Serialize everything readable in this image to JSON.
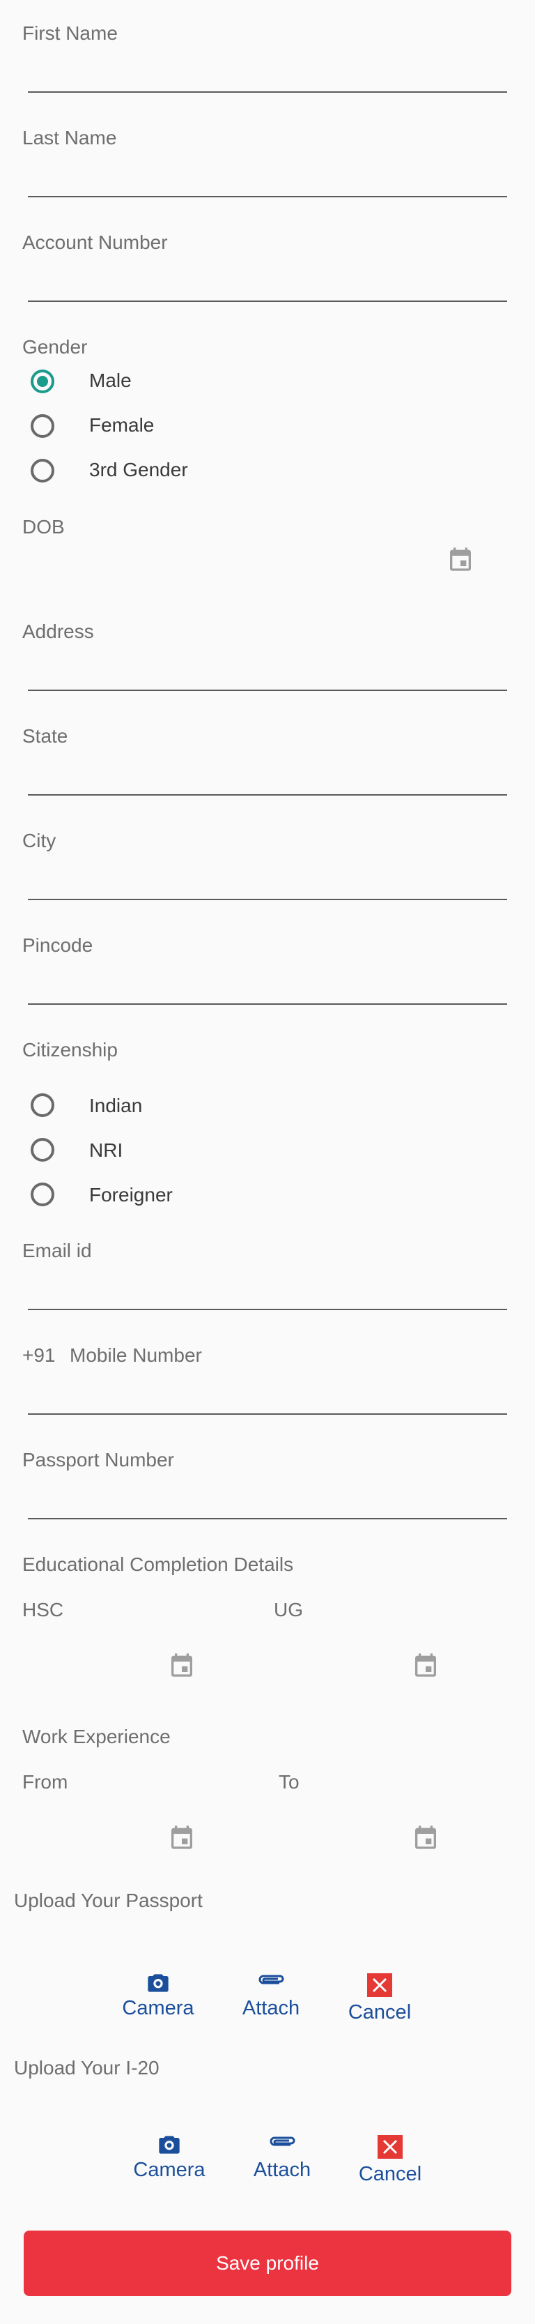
{
  "fields": {
    "first_name": "First Name",
    "last_name": "Last Name",
    "account_number": "Account Number",
    "dob": "DOB",
    "address": "Address",
    "state": "State",
    "city": "City",
    "pincode": "Pincode",
    "email": "Email id",
    "mobile_prefix": "+91",
    "mobile": "Mobile Number",
    "passport_number": "Passport Number"
  },
  "gender": {
    "label": "Gender",
    "options": [
      "Male",
      "Female",
      "3rd Gender"
    ],
    "selected": "Male"
  },
  "citizenship": {
    "label": "Citizenship",
    "options": [
      "Indian",
      "NRI",
      "Foreigner"
    ],
    "selected": ""
  },
  "education": {
    "label": "Educational Completion Details",
    "hsc": "HSC",
    "ug": "UG"
  },
  "work": {
    "label": "Work Experience",
    "from": "From",
    "to": "To"
  },
  "upload_passport": {
    "label": "Upload Your Passport",
    "camera": "Camera",
    "attach": "Attach",
    "cancel": "Cancel"
  },
  "upload_i20": {
    "label": "Upload Your I-20",
    "camera": "Camera",
    "attach": "Attach",
    "cancel": "Cancel"
  },
  "save_label": "Save profile",
  "colors": {
    "accent": "#1a9b8c",
    "primary_button": "#ec3340",
    "action_blue": "#1b4f9c",
    "cancel_red": "#e53935"
  }
}
